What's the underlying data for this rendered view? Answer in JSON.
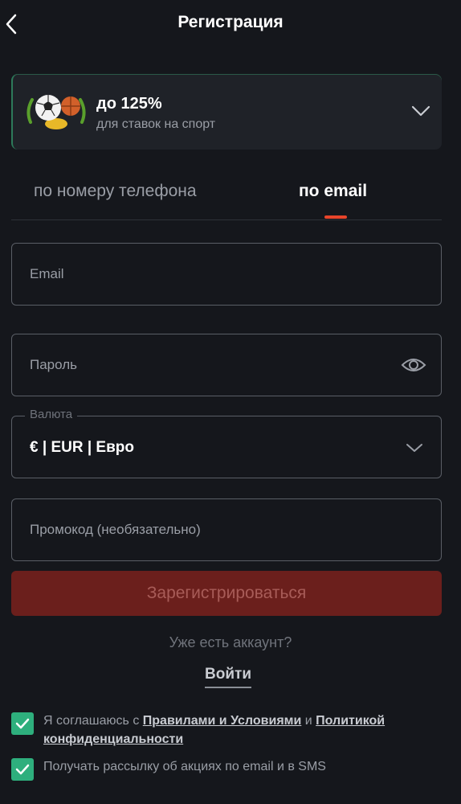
{
  "header": {
    "title": "Регистрация"
  },
  "bonus": {
    "title": "до 125%",
    "subtitle": "для ставок на спорт"
  },
  "tabs": [
    {
      "label": "по номеру телефона",
      "active": false
    },
    {
      "label": "по email",
      "active": true
    }
  ],
  "form": {
    "email_placeholder": "Email",
    "password_placeholder": "Пароль",
    "currency_label": "Валюта",
    "currency_value": "€ | EUR | Евро",
    "promo_placeholder": "Промокод (необязательно)"
  },
  "register_button": "Зарегистрироваться",
  "have_account": "Уже есть аккаунт?",
  "login_link": "Войти",
  "consents": {
    "terms_prefix": "Я соглашаюсь с ",
    "terms_link": "Правилами и Условиями",
    "terms_and": " и ",
    "privacy_link": "Политикой конфиденциальности",
    "newsletter": "Получать рассылку об акциях по email и в SMS"
  },
  "colors": {
    "background": "#15171c",
    "accent": "#e8442a",
    "checkbox": "#2eaf7d",
    "button_disabled": "#6b1f1c"
  }
}
